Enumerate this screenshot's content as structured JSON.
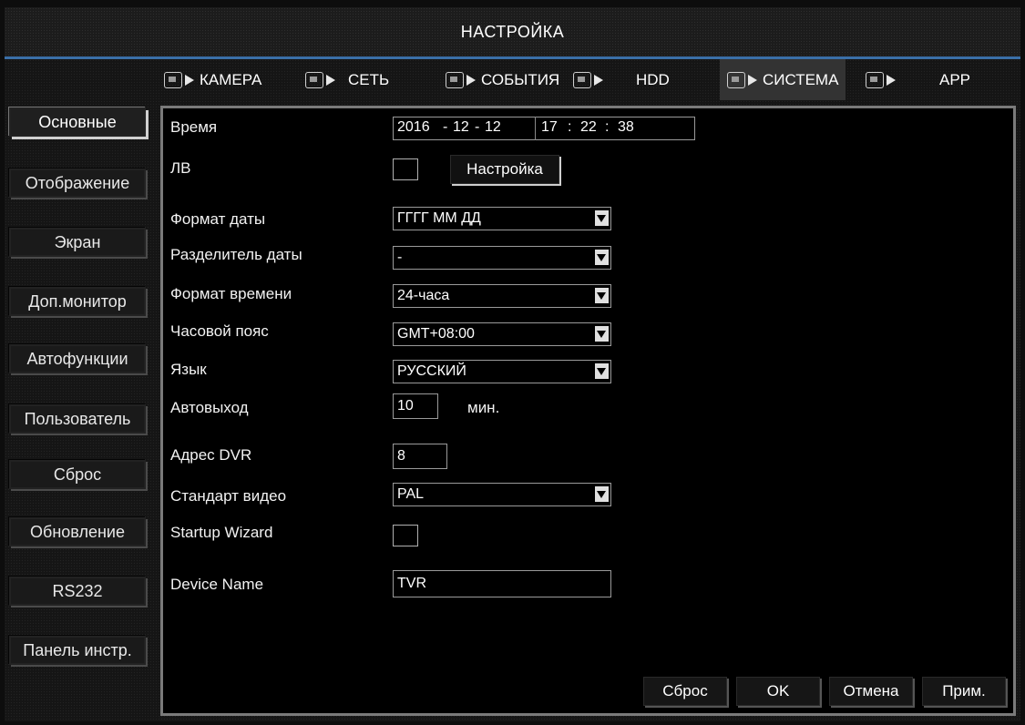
{
  "window": {
    "title": "НАСТРОЙКА"
  },
  "tabs": [
    {
      "label": "КАМЕРА",
      "icon": "camera-icon"
    },
    {
      "label": "СЕТЬ",
      "icon": "network-icon"
    },
    {
      "label": "СОБЫТИЯ",
      "icon": "alarm-icon"
    },
    {
      "label": "HDD",
      "icon": "hdd-icon"
    },
    {
      "label": "СИСТЕМА",
      "icon": "system-icon",
      "active": true
    },
    {
      "label": "APP",
      "icon": "app-icon"
    }
  ],
  "sidebar": {
    "items": [
      {
        "label": "Основные",
        "active": true
      },
      {
        "label": "Отображение"
      },
      {
        "label": "Экран"
      },
      {
        "label": "Доп.монитор"
      },
      {
        "label": "Автофункции"
      },
      {
        "label": "Пользователь"
      },
      {
        "label": "Сброс"
      },
      {
        "label": "Обновление"
      },
      {
        "label": "RS232"
      },
      {
        "label": "Панель инстр."
      }
    ]
  },
  "form": {
    "time_label": "Время",
    "date_year": "2016",
    "date_sep1": "-",
    "date_month": "12",
    "date_sep2": "-",
    "date_day": "12",
    "time_hh": "17",
    "time_sep1": ":",
    "time_mm": "22",
    "time_sep2": ":",
    "time_ss": "38",
    "dst_label": "ЛВ",
    "dst_checked": false,
    "dst_setup_button": "Настройка",
    "date_format_label": "Формат даты",
    "date_format_value": "ГГГГ ММ ДД",
    "date_separator_label": "Разделитель даты",
    "date_separator_value": "-",
    "time_format_label": "Формат времени",
    "time_format_value": "24-часа",
    "timezone_label": "Часовой пояс",
    "timezone_value": "GMT+08:00",
    "language_label": "Язык",
    "language_value": "РУССКИЙ",
    "autologout_label": "Автовыход",
    "autologout_value": "10",
    "autologout_unit": "мин.",
    "dvr_address_label": "Адрес DVR",
    "dvr_address_value": "8",
    "video_standard_label": "Стандарт видео",
    "video_standard_value": "PAL",
    "startup_wizard_label": "Startup Wizard",
    "startup_wizard_checked": false,
    "device_name_label": "Device Name",
    "device_name_value": "TVR"
  },
  "footer": {
    "reset_button": "Сброс",
    "ok_button": "OK",
    "cancel_button": "Отмена",
    "apply_button": "Прим."
  },
  "colors": {
    "accent": "#3a6fa8",
    "panel_border": "#7a7a7a",
    "background": "#151515"
  }
}
